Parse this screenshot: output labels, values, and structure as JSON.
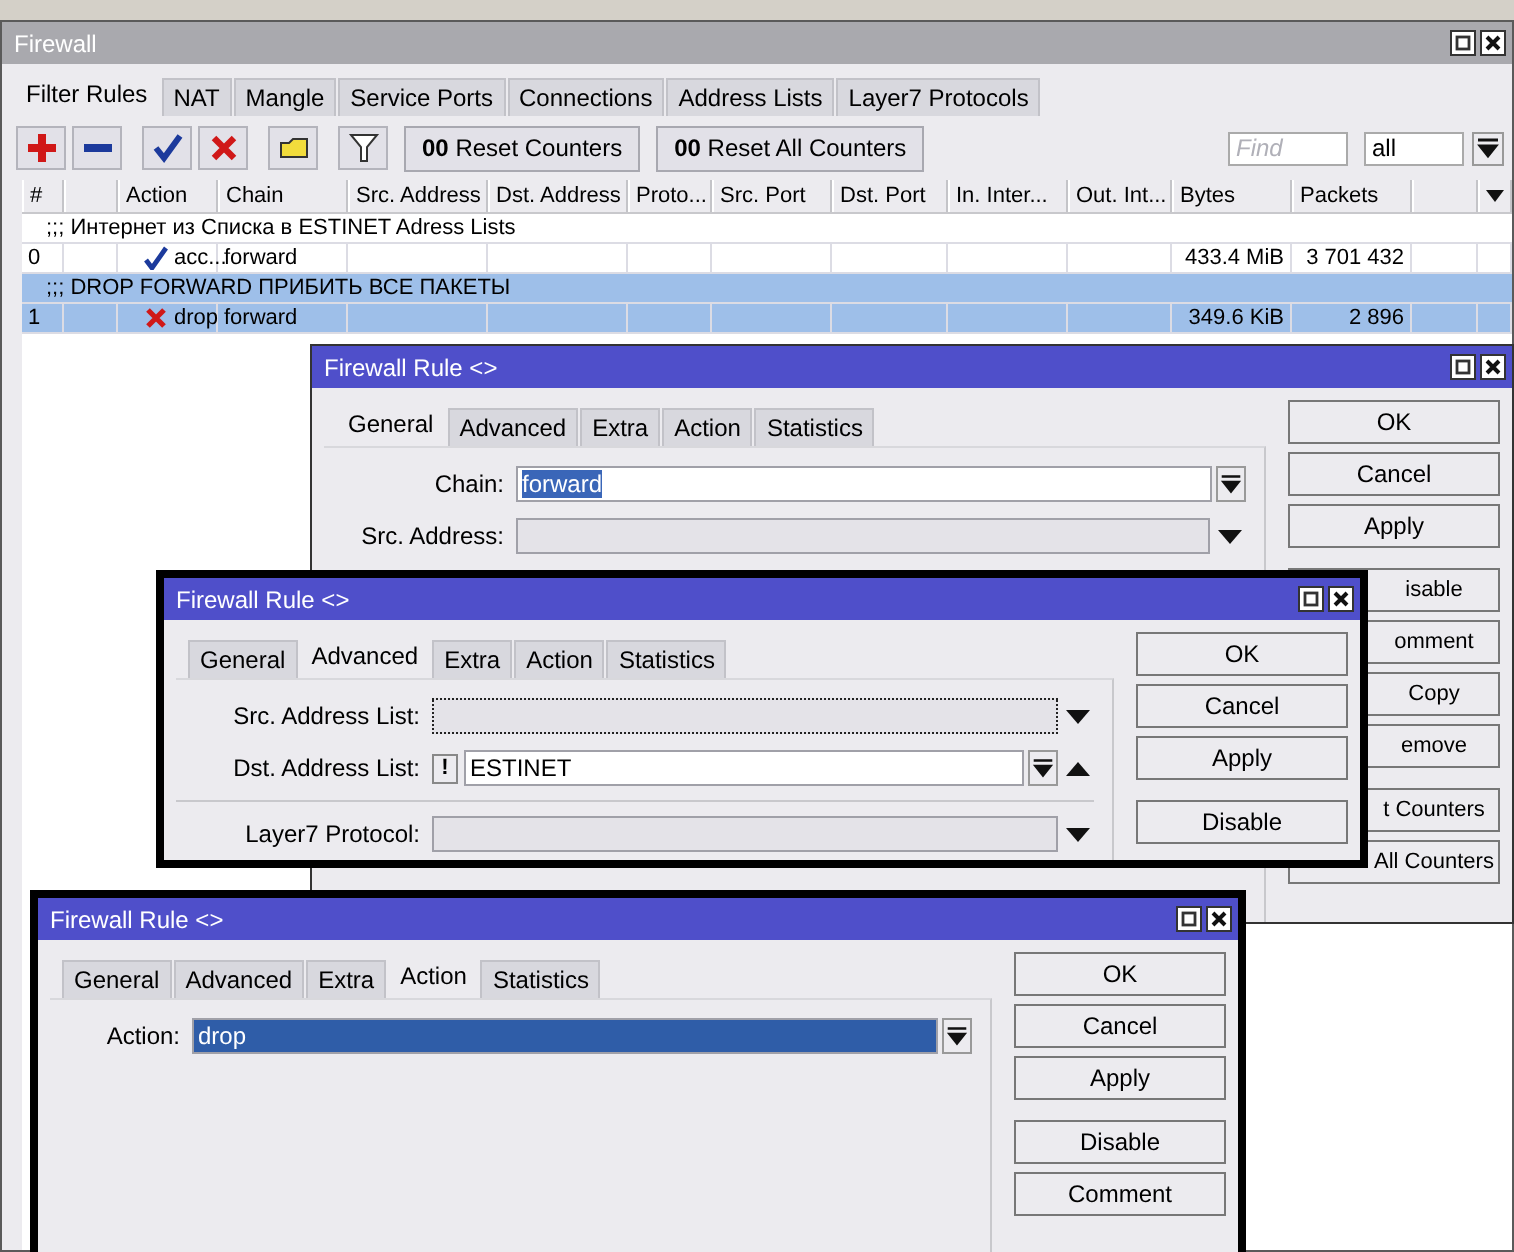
{
  "firewall_window": {
    "title": "Firewall",
    "tabs": [
      {
        "label": "Filter Rules",
        "selected": true
      },
      {
        "label": "NAT",
        "selected": false
      },
      {
        "label": "Mangle",
        "selected": false
      },
      {
        "label": "Service Ports",
        "selected": false
      },
      {
        "label": "Connections",
        "selected": false
      },
      {
        "label": "Address Lists",
        "selected": false
      },
      {
        "label": "Layer7 Protocols",
        "selected": false
      }
    ],
    "toolbar": {
      "icon_buttons": [
        {
          "kind": "add"
        },
        {
          "kind": "remove"
        },
        {
          "kind": "enable"
        },
        {
          "kind": "disable"
        },
        {
          "kind": "comment"
        },
        {
          "kind": "filter"
        }
      ],
      "text_buttons": [
        {
          "label": "**00** Reset Counters"
        },
        {
          "label": "**00** Reset All Counters"
        }
      ],
      "search": {
        "placeholder": "Find"
      },
      "filter": {
        "value": "all"
      }
    },
    "table": {
      "columns": [
        "#",
        "Action",
        "Chain",
        "Src. Address",
        "Dst. Address",
        "Proto...",
        "Src. Port",
        "Dst. Port",
        "In. Inter...",
        "Out. Int...",
        "Bytes",
        "Packets"
      ],
      "rows": [
        {
          "kind": "comment",
          "text": ";;; Интернет из Списка  в ESTINET Adress Lists",
          "selected": false
        },
        {
          "kind": "rule",
          "number": "0",
          "dropped": false,
          "action": "acc...",
          "chain": "forward",
          "bytes": "433.4 MiB",
          "packets": "3 701 432",
          "selected": false
        },
        {
          "kind": "comment",
          "text": ";;; DROP FORWARD ПРИБИТЬ ВСЕ ПАКЕТЫ",
          "selected": true
        },
        {
          "kind": "rule",
          "number": "1",
          "dropped": true,
          "action": "drop",
          "chain": "forward",
          "bytes": "349.6 KiB",
          "packets": "2 896",
          "selected": true
        }
      ]
    }
  },
  "rule_windows": [
    {
      "title": "Firewall Rule <>",
      "highlighted": false,
      "tabs": [
        {
          "label": "General",
          "selected": true
        },
        {
          "label": "Advanced",
          "selected": false
        },
        {
          "label": "Extra",
          "selected": false
        },
        {
          "label": "Action",
          "selected": false
        },
        {
          "label": "Statistics",
          "selected": false
        }
      ],
      "fields": [
        {
          "kind": "combo",
          "label": "Chain:",
          "value": "forward",
          "text_selected": true
        },
        {
          "kind": "dropdown",
          "label": "Src. Address:"
        }
      ],
      "button_groups": [
        [
          "OK",
          "Cancel",
          "Apply"
        ],
        [
          "isable",
          "omment",
          "Copy",
          "emove"
        ],
        [
          "t Counters",
          "All Counters"
        ]
      ]
    },
    {
      "title": "Firewall Rule <>",
      "highlighted": true,
      "tabs": [
        {
          "label": "General",
          "selected": false
        },
        {
          "label": "Advanced",
          "selected": true
        },
        {
          "label": "Extra",
          "selected": false
        },
        {
          "label": "Action",
          "selected": false
        },
        {
          "label": "Statistics",
          "selected": false
        }
      ],
      "fields": [
        {
          "kind": "dropdown",
          "label": "Src. Address List:",
          "focused": true
        },
        {
          "kind": "combo",
          "label": "Dst. Address List:",
          "negate": "!",
          "value": "ESTINET",
          "removable": true
        },
        {
          "kind": "separator"
        },
        {
          "kind": "dropdown",
          "label": "Layer7 Protocol:"
        }
      ],
      "button_groups": [
        [
          "OK",
          "Cancel",
          "Apply"
        ],
        [
          "Disable"
        ]
      ]
    },
    {
      "title": "Firewall Rule <>",
      "highlighted": true,
      "tabs": [
        {
          "label": "General",
          "selected": false
        },
        {
          "label": "Advanced",
          "selected": false
        },
        {
          "label": "Extra",
          "selected": false
        },
        {
          "label": "Action",
          "selected": true
        },
        {
          "label": "Statistics",
          "selected": false
        }
      ],
      "fields": [
        {
          "kind": "combo",
          "label": "Action:",
          "value": "drop",
          "field_selected": true
        }
      ],
      "button_groups": [
        [
          "OK",
          "Cancel",
          "Apply"
        ],
        [
          "Disable",
          "Comment"
        ]
      ]
    }
  ]
}
